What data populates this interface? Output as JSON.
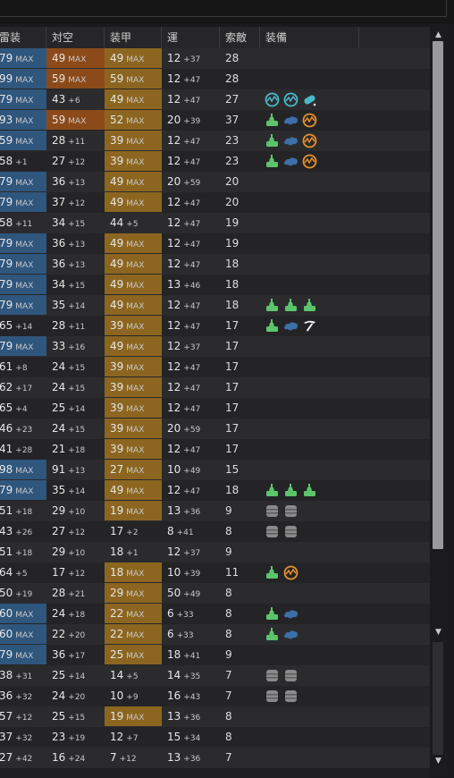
{
  "columns": [
    "雷装",
    "対空",
    "装甲",
    "運",
    "索敵",
    "装備"
  ],
  "rows": [
    {
      "torp": {
        "v": "79",
        "s": "MAX",
        "c": "blue"
      },
      "aa": {
        "v": "49",
        "s": "MAX",
        "c": "orange"
      },
      "armor": {
        "v": "49",
        "s": "MAX",
        "c": "gold"
      },
      "luck": {
        "v": "12",
        "s": "+37"
      },
      "los": "28",
      "equip": []
    },
    {
      "torp": {
        "v": "99",
        "s": "MAX",
        "c": "blue"
      },
      "aa": {
        "v": "59",
        "s": "MAX",
        "c": "orange"
      },
      "armor": {
        "v": "59",
        "s": "MAX",
        "c": "gold"
      },
      "luck": {
        "v": "12",
        "s": "+47"
      },
      "los": "28",
      "equip": []
    },
    {
      "torp": {
        "v": "79",
        "s": "MAX",
        "c": "blue"
      },
      "aa": {
        "v": "43",
        "s": "+6",
        "c": ""
      },
      "armor": {
        "v": "49",
        "s": "MAX",
        "c": "gold"
      },
      "luck": {
        "v": "12",
        "s": "+47"
      },
      "los": "27",
      "equip": [
        "radar-icon",
        "radar-icon",
        "sonar-icon"
      ]
    },
    {
      "torp": {
        "v": "93",
        "s": "MAX",
        "c": "blue"
      },
      "aa": {
        "v": "59",
        "s": "MAX",
        "c": "orange"
      },
      "armor": {
        "v": "52",
        "s": "MAX",
        "c": "gold"
      },
      "luck": {
        "v": "20",
        "s": "+39"
      },
      "los": "37",
      "equip": [
        "gun-green-icon",
        "turbine-icon",
        "boiler-icon"
      ]
    },
    {
      "torp": {
        "v": "59",
        "s": "MAX",
        "c": "blue"
      },
      "aa": {
        "v": "28",
        "s": "+11",
        "c": ""
      },
      "armor": {
        "v": "39",
        "s": "MAX",
        "c": "gold"
      },
      "luck": {
        "v": "12",
        "s": "+47"
      },
      "los": "23",
      "equip": [
        "gun-green-icon",
        "turbine-icon",
        "boiler-icon"
      ]
    },
    {
      "torp": {
        "v": "58",
        "s": "+1",
        "c": ""
      },
      "aa": {
        "v": "27",
        "s": "+12",
        "c": ""
      },
      "armor": {
        "v": "39",
        "s": "MAX",
        "c": "gold"
      },
      "luck": {
        "v": "12",
        "s": "+47"
      },
      "los": "23",
      "equip": [
        "gun-green-icon",
        "turbine-icon",
        "boiler-icon"
      ]
    },
    {
      "torp": {
        "v": "79",
        "s": "MAX",
        "c": "blue"
      },
      "aa": {
        "v": "36",
        "s": "+13",
        "c": ""
      },
      "armor": {
        "v": "49",
        "s": "MAX",
        "c": "gold"
      },
      "luck": {
        "v": "20",
        "s": "+59"
      },
      "los": "20",
      "equip": []
    },
    {
      "torp": {
        "v": "79",
        "s": "MAX",
        "c": "blue"
      },
      "aa": {
        "v": "37",
        "s": "+12",
        "c": ""
      },
      "armor": {
        "v": "49",
        "s": "MAX",
        "c": "gold"
      },
      "luck": {
        "v": "12",
        "s": "+47"
      },
      "los": "20",
      "equip": []
    },
    {
      "torp": {
        "v": "58",
        "s": "+11",
        "c": ""
      },
      "aa": {
        "v": "34",
        "s": "+15",
        "c": ""
      },
      "armor": {
        "v": "44",
        "s": "+5",
        "c": ""
      },
      "luck": {
        "v": "12",
        "s": "+47"
      },
      "los": "19",
      "equip": []
    },
    {
      "torp": {
        "v": "79",
        "s": "MAX",
        "c": "blue"
      },
      "aa": {
        "v": "36",
        "s": "+13",
        "c": ""
      },
      "armor": {
        "v": "49",
        "s": "MAX",
        "c": "gold"
      },
      "luck": {
        "v": "12",
        "s": "+47"
      },
      "los": "19",
      "equip": []
    },
    {
      "torp": {
        "v": "79",
        "s": "MAX",
        "c": "blue"
      },
      "aa": {
        "v": "36",
        "s": "+13",
        "c": ""
      },
      "armor": {
        "v": "49",
        "s": "MAX",
        "c": "gold"
      },
      "luck": {
        "v": "12",
        "s": "+47"
      },
      "los": "18",
      "equip": []
    },
    {
      "torp": {
        "v": "79",
        "s": "MAX",
        "c": "blue"
      },
      "aa": {
        "v": "34",
        "s": "+15",
        "c": ""
      },
      "armor": {
        "v": "49",
        "s": "MAX",
        "c": "gold"
      },
      "luck": {
        "v": "13",
        "s": "+46"
      },
      "los": "18",
      "equip": []
    },
    {
      "torp": {
        "v": "79",
        "s": "MAX",
        "c": "blue"
      },
      "aa": {
        "v": "35",
        "s": "+14",
        "c": ""
      },
      "armor": {
        "v": "49",
        "s": "MAX",
        "c": "gold"
      },
      "luck": {
        "v": "12",
        "s": "+47"
      },
      "los": "18",
      "equip": [
        "gun-green-icon",
        "gun-green-icon",
        "gun-green-icon"
      ]
    },
    {
      "torp": {
        "v": "65",
        "s": "+14",
        "c": ""
      },
      "aa": {
        "v": "28",
        "s": "+11",
        "c": ""
      },
      "armor": {
        "v": "39",
        "s": "MAX",
        "c": "gold"
      },
      "luck": {
        "v": "12",
        "s": "+47"
      },
      "los": "17",
      "equip": [
        "gun-green-icon",
        "turbine-icon",
        "pickaxe-icon"
      ]
    },
    {
      "torp": {
        "v": "79",
        "s": "MAX",
        "c": "blue"
      },
      "aa": {
        "v": "33",
        "s": "+16",
        "c": ""
      },
      "armor": {
        "v": "49",
        "s": "MAX",
        "c": "gold"
      },
      "luck": {
        "v": "12",
        "s": "+37"
      },
      "los": "17",
      "equip": []
    },
    {
      "torp": {
        "v": "61",
        "s": "+8",
        "c": ""
      },
      "aa": {
        "v": "24",
        "s": "+15",
        "c": ""
      },
      "armor": {
        "v": "39",
        "s": "MAX",
        "c": "gold"
      },
      "luck": {
        "v": "12",
        "s": "+47"
      },
      "los": "17",
      "equip": []
    },
    {
      "torp": {
        "v": "62",
        "s": "+17",
        "c": ""
      },
      "aa": {
        "v": "24",
        "s": "+15",
        "c": ""
      },
      "armor": {
        "v": "39",
        "s": "MAX",
        "c": "gold"
      },
      "luck": {
        "v": "12",
        "s": "+47"
      },
      "los": "17",
      "equip": []
    },
    {
      "torp": {
        "v": "65",
        "s": "+4",
        "c": ""
      },
      "aa": {
        "v": "25",
        "s": "+14",
        "c": ""
      },
      "armor": {
        "v": "39",
        "s": "MAX",
        "c": "gold"
      },
      "luck": {
        "v": "12",
        "s": "+47"
      },
      "los": "17",
      "equip": []
    },
    {
      "torp": {
        "v": "46",
        "s": "+23",
        "c": ""
      },
      "aa": {
        "v": "24",
        "s": "+15",
        "c": ""
      },
      "armor": {
        "v": "39",
        "s": "MAX",
        "c": "gold"
      },
      "luck": {
        "v": "20",
        "s": "+59"
      },
      "los": "17",
      "equip": []
    },
    {
      "torp": {
        "v": "41",
        "s": "+28",
        "c": ""
      },
      "aa": {
        "v": "21",
        "s": "+18",
        "c": ""
      },
      "armor": {
        "v": "39",
        "s": "MAX",
        "c": "gold"
      },
      "luck": {
        "v": "12",
        "s": "+47"
      },
      "los": "17",
      "equip": []
    },
    {
      "torp": {
        "v": "98",
        "s": "MAX",
        "c": "blue"
      },
      "aa": {
        "v": "91",
        "s": "+13",
        "c": ""
      },
      "armor": {
        "v": "27",
        "s": "MAX",
        "c": "gold"
      },
      "luck": {
        "v": "10",
        "s": "+49"
      },
      "los": "15",
      "equip": []
    },
    {
      "torp": {
        "v": "79",
        "s": "MAX",
        "c": "blue"
      },
      "aa": {
        "v": "35",
        "s": "+14",
        "c": ""
      },
      "armor": {
        "v": "49",
        "s": "MAX",
        "c": "gold"
      },
      "luck": {
        "v": "12",
        "s": "+47"
      },
      "los": "18",
      "equip": [
        "gun-green-icon",
        "gun-green-icon",
        "gun-green-icon"
      ]
    },
    {
      "torp": {
        "v": "51",
        "s": "+18",
        "c": ""
      },
      "aa": {
        "v": "29",
        "s": "+10",
        "c": ""
      },
      "armor": {
        "v": "19",
        "s": "MAX",
        "c": "gold"
      },
      "luck": {
        "v": "13",
        "s": "+36"
      },
      "los": "9",
      "equip": [
        "drum-icon",
        "drum-icon"
      ]
    },
    {
      "torp": {
        "v": "43",
        "s": "+26",
        "c": ""
      },
      "aa": {
        "v": "27",
        "s": "+12",
        "c": ""
      },
      "armor": {
        "v": "17",
        "s": "+2",
        "c": ""
      },
      "luck": {
        "v": "8",
        "s": "+41"
      },
      "los": "8",
      "equip": [
        "drum-icon",
        "drum-icon"
      ]
    },
    {
      "torp": {
        "v": "51",
        "s": "+18",
        "c": ""
      },
      "aa": {
        "v": "29",
        "s": "+10",
        "c": ""
      },
      "armor": {
        "v": "18",
        "s": "+1",
        "c": ""
      },
      "luck": {
        "v": "12",
        "s": "+37"
      },
      "los": "9",
      "equip": []
    },
    {
      "torp": {
        "v": "64",
        "s": "+5",
        "c": ""
      },
      "aa": {
        "v": "17",
        "s": "+12",
        "c": ""
      },
      "armor": {
        "v": "18",
        "s": "MAX",
        "c": "gold"
      },
      "luck": {
        "v": "10",
        "s": "+39"
      },
      "los": "11",
      "equip": [
        "gun-green-icon",
        "boiler-icon"
      ]
    },
    {
      "torp": {
        "v": "50",
        "s": "+19",
        "c": ""
      },
      "aa": {
        "v": "28",
        "s": "+21",
        "c": ""
      },
      "armor": {
        "v": "29",
        "s": "MAX",
        "c": "gold"
      },
      "luck": {
        "v": "50",
        "s": "+49"
      },
      "los": "8",
      "equip": []
    },
    {
      "torp": {
        "v": "60",
        "s": "MAX",
        "c": "blue"
      },
      "aa": {
        "v": "24",
        "s": "+18",
        "c": ""
      },
      "armor": {
        "v": "22",
        "s": "MAX",
        "c": "gold"
      },
      "luck": {
        "v": "6",
        "s": "+33"
      },
      "los": "8",
      "equip": [
        "gun-green-icon",
        "turbine-icon"
      ]
    },
    {
      "torp": {
        "v": "60",
        "s": "MAX",
        "c": "blue"
      },
      "aa": {
        "v": "22",
        "s": "+20",
        "c": ""
      },
      "armor": {
        "v": "22",
        "s": "MAX",
        "c": "gold"
      },
      "luck": {
        "v": "6",
        "s": "+33"
      },
      "los": "8",
      "equip": [
        "gun-green-icon",
        "turbine-icon"
      ]
    },
    {
      "torp": {
        "v": "79",
        "s": "MAX",
        "c": "blue"
      },
      "aa": {
        "v": "36",
        "s": "+17",
        "c": ""
      },
      "armor": {
        "v": "25",
        "s": "MAX",
        "c": "gold"
      },
      "luck": {
        "v": "18",
        "s": "+41"
      },
      "los": "9",
      "equip": []
    },
    {
      "torp": {
        "v": "38",
        "s": "+31",
        "c": ""
      },
      "aa": {
        "v": "25",
        "s": "+14",
        "c": ""
      },
      "armor": {
        "v": "14",
        "s": "+5",
        "c": ""
      },
      "luck": {
        "v": "14",
        "s": "+35"
      },
      "los": "7",
      "equip": [
        "drum-icon",
        "drum-icon"
      ]
    },
    {
      "torp": {
        "v": "36",
        "s": "+32",
        "c": ""
      },
      "aa": {
        "v": "24",
        "s": "+20",
        "c": ""
      },
      "armor": {
        "v": "10",
        "s": "+9",
        "c": ""
      },
      "luck": {
        "v": "16",
        "s": "+43"
      },
      "los": "7",
      "equip": [
        "drum-icon",
        "drum-icon"
      ]
    },
    {
      "torp": {
        "v": "57",
        "s": "+12",
        "c": ""
      },
      "aa": {
        "v": "25",
        "s": "+15",
        "c": ""
      },
      "armor": {
        "v": "19",
        "s": "MAX",
        "c": "gold"
      },
      "luck": {
        "v": "13",
        "s": "+36"
      },
      "los": "8",
      "equip": []
    },
    {
      "torp": {
        "v": "37",
        "s": "+32",
        "c": ""
      },
      "aa": {
        "v": "23",
        "s": "+19",
        "c": ""
      },
      "armor": {
        "v": "12",
        "s": "+7",
        "c": ""
      },
      "luck": {
        "v": "15",
        "s": "+34"
      },
      "los": "8",
      "equip": []
    },
    {
      "torp": {
        "v": "27",
        "s": "+42",
        "c": ""
      },
      "aa": {
        "v": "16",
        "s": "+24",
        "c": ""
      },
      "armor": {
        "v": "7",
        "s": "+12",
        "c": ""
      },
      "luck": {
        "v": "13",
        "s": "+36"
      },
      "los": "7",
      "equip": []
    }
  ],
  "scrollbar": {
    "up": "▲",
    "down": "▼",
    "split": "▼"
  },
  "colors": {
    "blue": "#2f567d",
    "orange": "#8c4a1a",
    "gold": "#8c6620",
    "green": "#5cc46a",
    "turbine": "#3d6fa8",
    "boiler": "#e8902a",
    "radar": "#4ab8c8",
    "drum": "#8a8a8a"
  }
}
